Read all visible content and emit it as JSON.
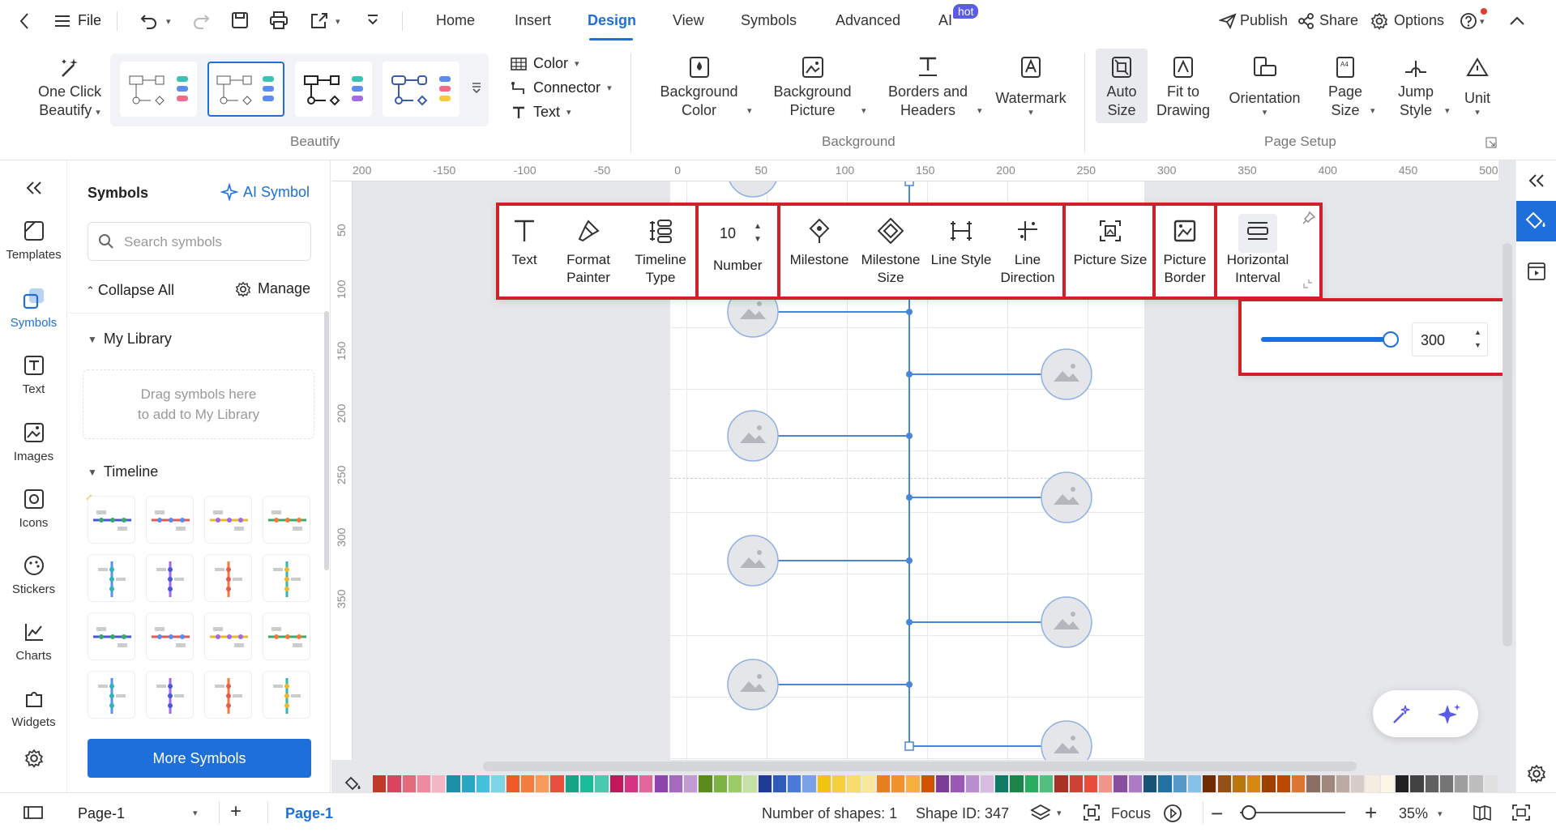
{
  "menubar": {
    "file_label": "File",
    "tabs": [
      "Home",
      "Insert",
      "Design",
      "View",
      "Symbols",
      "Advanced",
      "AI"
    ],
    "ai_badge": "hot",
    "publish": "Publish",
    "share": "Share",
    "options": "Options"
  },
  "ribbon": {
    "one_click_line1": "One Click",
    "one_click_line2": "Beautify",
    "color": "Color",
    "connector": "Connector",
    "text": "Text",
    "bg_color_1": "Background",
    "bg_color_2": "Color",
    "bg_picture_1": "Background",
    "bg_picture_2": "Picture",
    "borders_1": "Borders and",
    "borders_2": "Headers",
    "watermark": "Watermark",
    "auto_size_1": "Auto",
    "auto_size_2": "Size",
    "fit_1": "Fit to",
    "fit_2": "Drawing",
    "orientation": "Orientation",
    "page_size_1": "Page",
    "page_size_2": "Size",
    "jump_1": "Jump",
    "jump_2": "Style",
    "unit": "Unit",
    "group_beautify": "Beautify",
    "group_background": "Background",
    "group_page_setup": "Page Setup"
  },
  "rail": {
    "items": [
      "Templates",
      "Symbols",
      "Text",
      "Images",
      "Icons",
      "Stickers",
      "Charts",
      "Widgets"
    ]
  },
  "symbols_panel": {
    "title": "Symbols",
    "ai_symbol": "AI Symbol",
    "search_placeholder": "Search symbols",
    "collapse_all": "Collapse All",
    "manage": "Manage",
    "my_library": "My Library",
    "drag_hint_1": "Drag symbols here",
    "drag_hint_2": "to add to My Library",
    "timeline": "Timeline",
    "more_symbols": "More Symbols"
  },
  "ruler": {
    "h": [
      "200",
      "-150",
      "-100",
      "-50",
      "0",
      "50",
      "100",
      "150",
      "200",
      "250",
      "300",
      "350",
      "400",
      "450",
      "500"
    ],
    "v": [
      "50",
      "100",
      "150",
      "200",
      "250",
      "300",
      "350"
    ]
  },
  "float_toolbar": {
    "text": "Text",
    "format_painter_1": "Format",
    "format_painter_2": "Painter",
    "timeline_type_1": "Timeline",
    "timeline_type_2": "Type",
    "number_value": "10",
    "number": "Number",
    "milestone": "Milestone",
    "milestone_size_1": "Milestone",
    "milestone_size_2": "Size",
    "line_style": "Line Style",
    "line_direction_1": "Line",
    "line_direction_2": "Direction",
    "picture_size": "Picture Size",
    "picture_border_1": "Picture",
    "picture_border_2": "Border",
    "horizontal_interval_1": "Horizontal",
    "horizontal_interval_2": "Interval"
  },
  "interval_popup": {
    "value": "300",
    "slider_fraction": 1.0
  },
  "statusbar": {
    "page_select": "Page-1",
    "page_tab": "Page-1",
    "num_shapes": "Number of shapes: 1",
    "shape_id": "Shape ID: 347",
    "focus": "Focus",
    "zoom": "35%"
  },
  "colors": {
    "accent": "#1e6fd9",
    "highlight": "#d2202b",
    "timeline_line": "#4a86d8"
  }
}
